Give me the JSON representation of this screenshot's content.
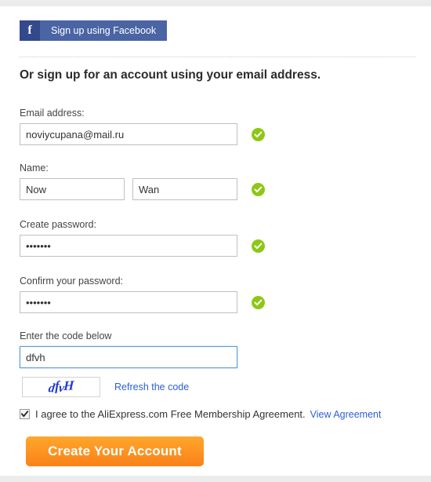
{
  "social": {
    "facebook_icon": "facebook-f-icon",
    "facebook_label": "Sign up using Facebook"
  },
  "heading": "Or sign up for an account using your email address.",
  "form": {
    "email": {
      "label": "Email address:",
      "value": "noviycupana@mail.ru",
      "placeholder": "",
      "valid": "valid-check-icon"
    },
    "name": {
      "label": "Name:",
      "first_value": "Now",
      "last_value": "Wan",
      "first_placeholder": "",
      "last_placeholder": "",
      "valid": "valid-check-icon"
    },
    "password": {
      "label": "Create password:",
      "value": "•••••••",
      "placeholder": "",
      "valid": "valid-check-icon"
    },
    "confirm_password": {
      "label": "Confirm your password:",
      "value": "•••••••",
      "placeholder": "",
      "valid": "valid-check-icon"
    },
    "captcha": {
      "label": "Enter the code below",
      "value": "dfvh",
      "placeholder": "",
      "image_text": "dfvH",
      "refresh_label": "Refresh the code"
    }
  },
  "agreement": {
    "checked": true,
    "text": "I agree to the AliExpress.com Free Membership Agreement.",
    "link_label": "View Agreement"
  },
  "submit_label": "Create Your Account",
  "colors": {
    "facebook_blue": "#4a64a4",
    "facebook_blue_dark": "#33498b",
    "valid_green": "#8dc814",
    "link_blue": "#2b5fd9",
    "captcha_blue": "#2138d4",
    "button_orange": "#fd9322",
    "focus_blue": "#5b9bd5"
  }
}
